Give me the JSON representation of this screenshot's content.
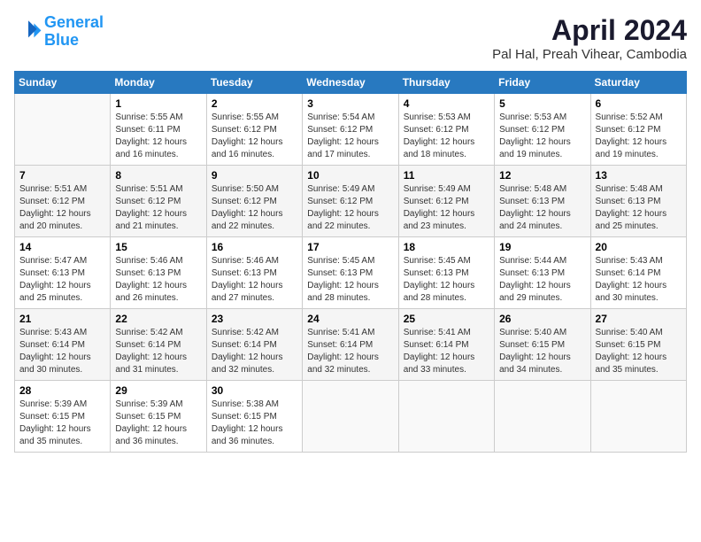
{
  "header": {
    "logo_line1": "General",
    "logo_line2": "Blue",
    "title": "April 2024",
    "subtitle": "Pal Hal, Preah Vihear, Cambodia"
  },
  "days_of_week": [
    "Sunday",
    "Monday",
    "Tuesday",
    "Wednesday",
    "Thursday",
    "Friday",
    "Saturday"
  ],
  "weeks": [
    [
      {
        "day": "",
        "info": ""
      },
      {
        "day": "1",
        "info": "Sunrise: 5:55 AM\nSunset: 6:11 PM\nDaylight: 12 hours\nand 16 minutes."
      },
      {
        "day": "2",
        "info": "Sunrise: 5:55 AM\nSunset: 6:12 PM\nDaylight: 12 hours\nand 16 minutes."
      },
      {
        "day": "3",
        "info": "Sunrise: 5:54 AM\nSunset: 6:12 PM\nDaylight: 12 hours\nand 17 minutes."
      },
      {
        "day": "4",
        "info": "Sunrise: 5:53 AM\nSunset: 6:12 PM\nDaylight: 12 hours\nand 18 minutes."
      },
      {
        "day": "5",
        "info": "Sunrise: 5:53 AM\nSunset: 6:12 PM\nDaylight: 12 hours\nand 19 minutes."
      },
      {
        "day": "6",
        "info": "Sunrise: 5:52 AM\nSunset: 6:12 PM\nDaylight: 12 hours\nand 19 minutes."
      }
    ],
    [
      {
        "day": "7",
        "info": "Sunrise: 5:51 AM\nSunset: 6:12 PM\nDaylight: 12 hours\nand 20 minutes."
      },
      {
        "day": "8",
        "info": "Sunrise: 5:51 AM\nSunset: 6:12 PM\nDaylight: 12 hours\nand 21 minutes."
      },
      {
        "day": "9",
        "info": "Sunrise: 5:50 AM\nSunset: 6:12 PM\nDaylight: 12 hours\nand 22 minutes."
      },
      {
        "day": "10",
        "info": "Sunrise: 5:49 AM\nSunset: 6:12 PM\nDaylight: 12 hours\nand 22 minutes."
      },
      {
        "day": "11",
        "info": "Sunrise: 5:49 AM\nSunset: 6:12 PM\nDaylight: 12 hours\nand 23 minutes."
      },
      {
        "day": "12",
        "info": "Sunrise: 5:48 AM\nSunset: 6:13 PM\nDaylight: 12 hours\nand 24 minutes."
      },
      {
        "day": "13",
        "info": "Sunrise: 5:48 AM\nSunset: 6:13 PM\nDaylight: 12 hours\nand 25 minutes."
      }
    ],
    [
      {
        "day": "14",
        "info": "Sunrise: 5:47 AM\nSunset: 6:13 PM\nDaylight: 12 hours\nand 25 minutes."
      },
      {
        "day": "15",
        "info": "Sunrise: 5:46 AM\nSunset: 6:13 PM\nDaylight: 12 hours\nand 26 minutes."
      },
      {
        "day": "16",
        "info": "Sunrise: 5:46 AM\nSunset: 6:13 PM\nDaylight: 12 hours\nand 27 minutes."
      },
      {
        "day": "17",
        "info": "Sunrise: 5:45 AM\nSunset: 6:13 PM\nDaylight: 12 hours\nand 28 minutes."
      },
      {
        "day": "18",
        "info": "Sunrise: 5:45 AM\nSunset: 6:13 PM\nDaylight: 12 hours\nand 28 minutes."
      },
      {
        "day": "19",
        "info": "Sunrise: 5:44 AM\nSunset: 6:13 PM\nDaylight: 12 hours\nand 29 minutes."
      },
      {
        "day": "20",
        "info": "Sunrise: 5:43 AM\nSunset: 6:14 PM\nDaylight: 12 hours\nand 30 minutes."
      }
    ],
    [
      {
        "day": "21",
        "info": "Sunrise: 5:43 AM\nSunset: 6:14 PM\nDaylight: 12 hours\nand 30 minutes."
      },
      {
        "day": "22",
        "info": "Sunrise: 5:42 AM\nSunset: 6:14 PM\nDaylight: 12 hours\nand 31 minutes."
      },
      {
        "day": "23",
        "info": "Sunrise: 5:42 AM\nSunset: 6:14 PM\nDaylight: 12 hours\nand 32 minutes."
      },
      {
        "day": "24",
        "info": "Sunrise: 5:41 AM\nSunset: 6:14 PM\nDaylight: 12 hours\nand 32 minutes."
      },
      {
        "day": "25",
        "info": "Sunrise: 5:41 AM\nSunset: 6:14 PM\nDaylight: 12 hours\nand 33 minutes."
      },
      {
        "day": "26",
        "info": "Sunrise: 5:40 AM\nSunset: 6:15 PM\nDaylight: 12 hours\nand 34 minutes."
      },
      {
        "day": "27",
        "info": "Sunrise: 5:40 AM\nSunset: 6:15 PM\nDaylight: 12 hours\nand 35 minutes."
      }
    ],
    [
      {
        "day": "28",
        "info": "Sunrise: 5:39 AM\nSunset: 6:15 PM\nDaylight: 12 hours\nand 35 minutes."
      },
      {
        "day": "29",
        "info": "Sunrise: 5:39 AM\nSunset: 6:15 PM\nDaylight: 12 hours\nand 36 minutes."
      },
      {
        "day": "30",
        "info": "Sunrise: 5:38 AM\nSunset: 6:15 PM\nDaylight: 12 hours\nand 36 minutes."
      },
      {
        "day": "",
        "info": ""
      },
      {
        "day": "",
        "info": ""
      },
      {
        "day": "",
        "info": ""
      },
      {
        "day": "",
        "info": ""
      }
    ]
  ]
}
